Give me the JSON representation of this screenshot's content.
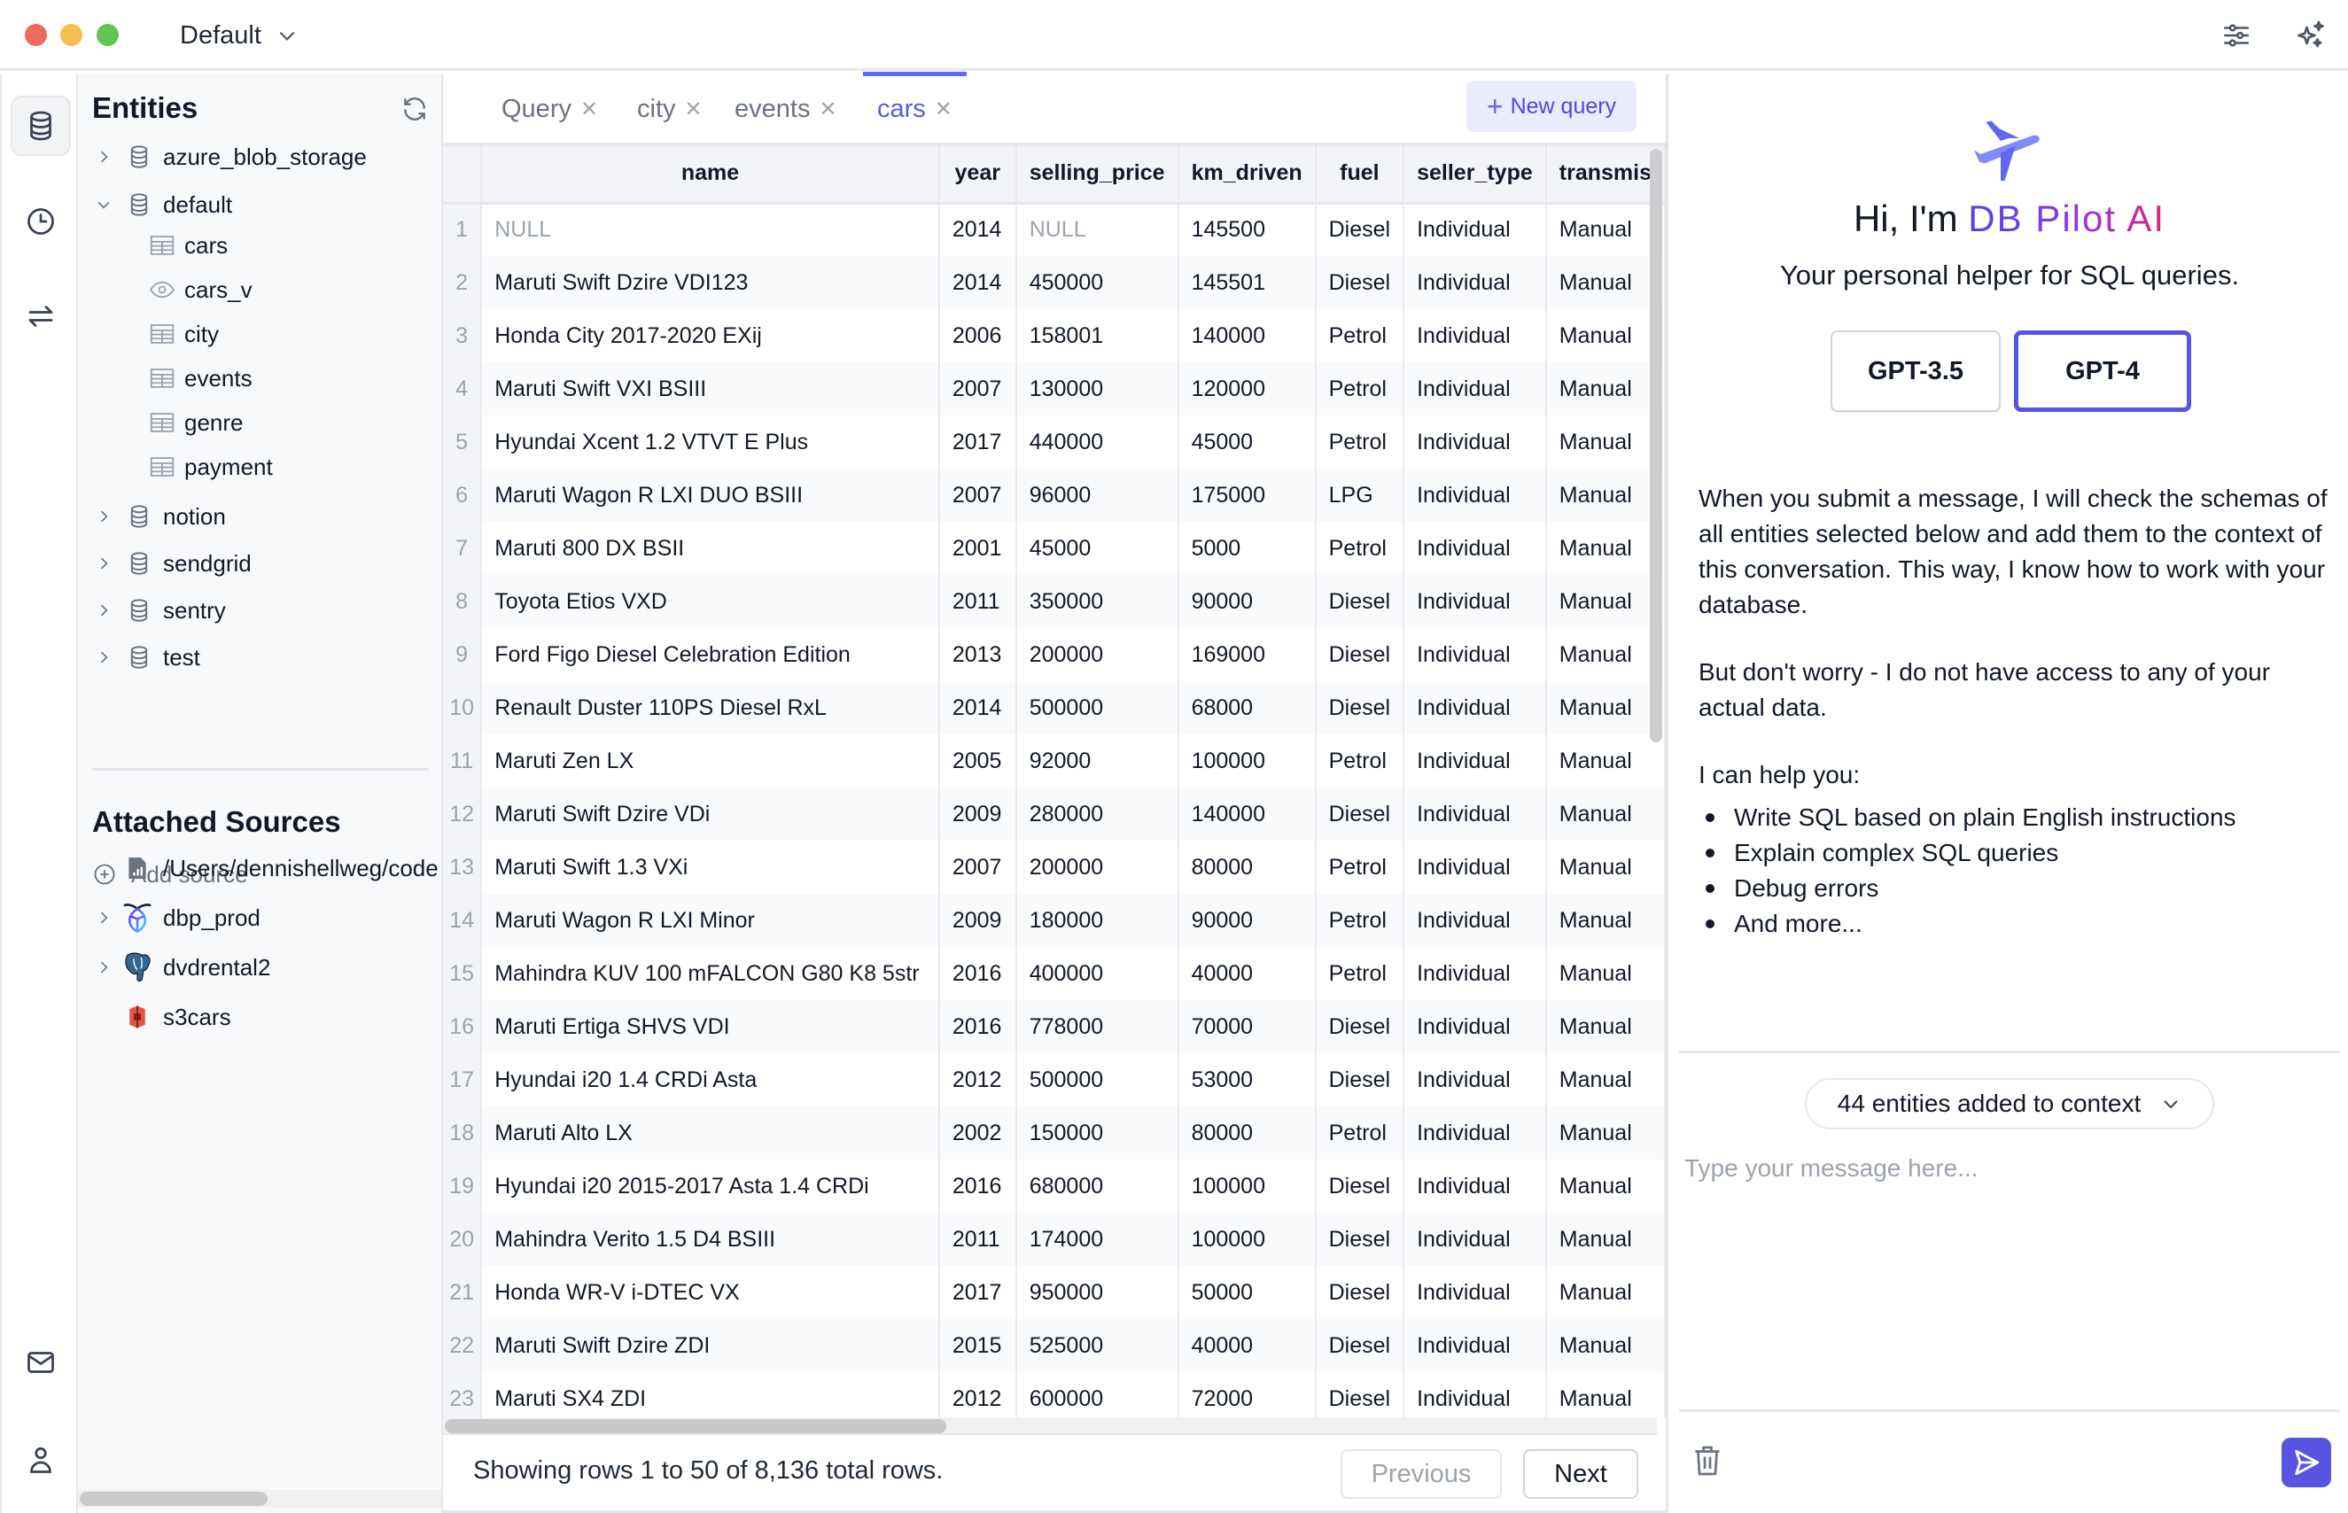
{
  "titlebar": {
    "workspace": "Default",
    "icons": [
      "settings-sliders-icon",
      "sparkles-icon"
    ]
  },
  "rail": {
    "items": [
      "database-icon",
      "history-clock-icon",
      "transfer-arrows-icon"
    ],
    "bottom": [
      "mail-icon",
      "user-icon"
    ]
  },
  "sidebar": {
    "entities_title": "Entities",
    "entities": [
      {
        "name": "azure_blob_storage",
        "type": "database",
        "expanded": false
      },
      {
        "name": "default",
        "type": "database",
        "expanded": true,
        "children": [
          {
            "name": "cars",
            "type": "table"
          },
          {
            "name": "cars_v",
            "type": "view"
          },
          {
            "name": "city",
            "type": "table"
          },
          {
            "name": "events",
            "type": "table"
          },
          {
            "name": "genre",
            "type": "table"
          },
          {
            "name": "payment",
            "type": "table"
          }
        ]
      },
      {
        "name": "notion",
        "type": "database",
        "expanded": false
      },
      {
        "name": "sendgrid",
        "type": "database",
        "expanded": false
      },
      {
        "name": "sentry",
        "type": "database",
        "expanded": false
      },
      {
        "name": "test",
        "type": "database",
        "expanded": false
      }
    ],
    "attached_title": "Attached Sources",
    "add_source": "Add source",
    "sources": [
      {
        "name": "/Users/dennishellweg/code",
        "icon": "file-chart-icon",
        "expandable": false
      },
      {
        "name": "dbp_prod",
        "icon": "cockroach-db-icon",
        "expandable": true
      },
      {
        "name": "dvdrental2",
        "icon": "postgres-elephant-icon",
        "expandable": true
      },
      {
        "name": "s3cars",
        "icon": "aws-s3-icon",
        "expandable": false
      }
    ]
  },
  "tabs": {
    "items": [
      {
        "label": "Query",
        "active": false
      },
      {
        "label": "city",
        "active": false
      },
      {
        "label": "events",
        "active": false
      },
      {
        "label": "cars",
        "active": true
      }
    ],
    "close_glyph": "✕",
    "new_query": "New query"
  },
  "grid": {
    "columns": [
      "name",
      "year",
      "selling_price",
      "km_driven",
      "fuel",
      "seller_type",
      "transmis"
    ],
    "rows": [
      [
        "NULL",
        "2014",
        "NULL",
        "145500",
        "Diesel",
        "Individual",
        "Manual"
      ],
      [
        "Maruti Swift Dzire VDI123",
        "2014",
        "450000",
        "145501",
        "Diesel",
        "Individual",
        "Manual"
      ],
      [
        "Honda City 2017-2020 EXij",
        "2006",
        "158001",
        "140000",
        "Petrol",
        "Individual",
        "Manual"
      ],
      [
        "Maruti Swift VXI BSIII",
        "2007",
        "130000",
        "120000",
        "Petrol",
        "Individual",
        "Manual"
      ],
      [
        "Hyundai Xcent 1.2 VTVT E Plus",
        "2017",
        "440000",
        "45000",
        "Petrol",
        "Individual",
        "Manual"
      ],
      [
        "Maruti Wagon R LXI DUO BSIII",
        "2007",
        "96000",
        "175000",
        "LPG",
        "Individual",
        "Manual"
      ],
      [
        "Maruti 800 DX BSII",
        "2001",
        "45000",
        "5000",
        "Petrol",
        "Individual",
        "Manual"
      ],
      [
        "Toyota Etios VXD",
        "2011",
        "350000",
        "90000",
        "Diesel",
        "Individual",
        "Manual"
      ],
      [
        "Ford Figo Diesel Celebration Edition",
        "2013",
        "200000",
        "169000",
        "Diesel",
        "Individual",
        "Manual"
      ],
      [
        "Renault Duster 110PS Diesel RxL",
        "2014",
        "500000",
        "68000",
        "Diesel",
        "Individual",
        "Manual"
      ],
      [
        "Maruti Zen LX",
        "2005",
        "92000",
        "100000",
        "Petrol",
        "Individual",
        "Manual"
      ],
      [
        "Maruti Swift Dzire VDi",
        "2009",
        "280000",
        "140000",
        "Diesel",
        "Individual",
        "Manual"
      ],
      [
        "Maruti Swift 1.3 VXi",
        "2007",
        "200000",
        "80000",
        "Petrol",
        "Individual",
        "Manual"
      ],
      [
        "Maruti Wagon R LXI Minor",
        "2009",
        "180000",
        "90000",
        "Petrol",
        "Individual",
        "Manual"
      ],
      [
        "Mahindra KUV 100 mFALCON G80 K8 5str",
        "2016",
        "400000",
        "40000",
        "Petrol",
        "Individual",
        "Manual"
      ],
      [
        "Maruti Ertiga SHVS VDI",
        "2016",
        "778000",
        "70000",
        "Diesel",
        "Individual",
        "Manual"
      ],
      [
        "Hyundai i20 1.4 CRDi Asta",
        "2012",
        "500000",
        "53000",
        "Diesel",
        "Individual",
        "Manual"
      ],
      [
        "Maruti Alto LX",
        "2002",
        "150000",
        "80000",
        "Petrol",
        "Individual",
        "Manual"
      ],
      [
        "Hyundai i20 2015-2017 Asta 1.4 CRDi",
        "2016",
        "680000",
        "100000",
        "Diesel",
        "Individual",
        "Manual"
      ],
      [
        "Mahindra Verito 1.5 D4 BSIII",
        "2011",
        "174000",
        "100000",
        "Diesel",
        "Individual",
        "Manual"
      ],
      [
        "Honda WR-V i-DTEC VX",
        "2017",
        "950000",
        "50000",
        "Diesel",
        "Individual",
        "Manual"
      ],
      [
        "Maruti Swift Dzire ZDI",
        "2015",
        "525000",
        "40000",
        "Diesel",
        "Individual",
        "Manual"
      ],
      [
        "Maruti SX4 ZDI",
        "2012",
        "600000",
        "72000",
        "Diesel",
        "Individual",
        "Manual"
      ]
    ],
    "null_label": "NULL"
  },
  "footer": {
    "status": "Showing rows 1 to 50 of 8,136 total rows.",
    "previous": "Previous",
    "next": "Next"
  },
  "ai": {
    "greeting": "Hi, I'm",
    "brand": "DB Pilot AI",
    "subtitle": "Your personal helper for SQL queries.",
    "models": [
      {
        "label": "GPT-3.5",
        "selected": false
      },
      {
        "label": "GPT-4",
        "selected": true
      }
    ],
    "intro_1": "When you submit a message, I will check the schemas of all entities selected below and add them to the context of this conversation. This way, I know how to work with your database.",
    "intro_2": "But don't worry - I do not have access to any of your actual data.",
    "intro_3": "I can help you:",
    "capabilities": [
      "Write SQL based on plain English instructions",
      "Explain complex SQL queries",
      "Debug errors",
      "And more..."
    ],
    "context_pill": "44 entities added to context",
    "input_placeholder": "Type your message here...",
    "input_value": ""
  },
  "colors": {
    "accent": "#5654e0",
    "tab_active": "#5b5bd6",
    "new_query_bg": "#e8ecfd",
    "sidebar_bg": "#f8f9fb"
  }
}
